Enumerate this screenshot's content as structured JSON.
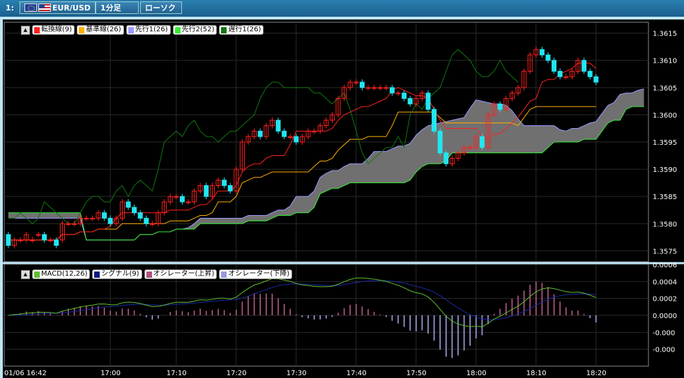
{
  "toolbar": {
    "index": "1:",
    "symbol": "EUR/USD",
    "timeframe": "1分足",
    "chart_style": "ローソク"
  },
  "legend_main": [
    {
      "label": "転換線(9)",
      "color": "#ff2020"
    },
    {
      "label": "基準線(26)",
      "color": "#ffb000"
    },
    {
      "label": "先行1(26)",
      "color": "#9999ff"
    },
    {
      "label": "先行2(52)",
      "color": "#33ee33"
    },
    {
      "label": "遅行1(26)",
      "color": "#117711"
    }
  ],
  "legend_sub": [
    {
      "label": "MACD(12,26)",
      "color": "#5fbf2f"
    },
    {
      "label": "シグナル(9)",
      "color": "#0a1a80"
    },
    {
      "label": "オシレーター(上昇)",
      "color": "#b05080"
    },
    {
      "label": "オシレーター(下降)",
      "color": "#9999dd"
    }
  ],
  "collapse_symbol": "▲",
  "colors": {
    "up": "#ff2020",
    "down": "#22e5f0",
    "cloud": "#707070",
    "grid": "#2a2a2a",
    "tenkan": "#ff2020",
    "kijun": "#ffb000",
    "senkou_a": "#9999ff",
    "senkou_b": "#33ee33",
    "chikou": "#117711",
    "macd": "#5fbf2f",
    "signal": "#1c2aa0",
    "osc_up": "#c06090",
    "osc_down": "#aaaaee"
  },
  "chart_data": [
    {
      "type": "candlestick",
      "title": "EUR/USD",
      "y_ticks": [
        "1.3615",
        "1.3610",
        "1.3605",
        "1.3600",
        "1.3595",
        "1.3590",
        "1.3585",
        "1.3580",
        "1.3575"
      ],
      "ylim": [
        1.3573,
        1.3617
      ],
      "x_ticks": [
        "01/06 16:42",
        "17:00",
        "17:10",
        "17:20",
        "17:30",
        "17:40",
        "17:50",
        "18:00",
        "18:10",
        "18:20"
      ],
      "bars": 100,
      "candles": [
        [
          1.3578,
          1.3576
        ],
        [
          1.3576,
          1.3577
        ],
        [
          1.3577,
          1.3577
        ],
        [
          1.3577,
          1.3578
        ],
        [
          1.3577,
          1.3577
        ],
        [
          1.3578,
          1.3578
        ],
        [
          1.3578,
          1.3577
        ],
        [
          1.3577,
          1.3577
        ],
        [
          1.3577,
          1.3576
        ],
        [
          1.3577,
          1.358
        ],
        [
          1.358,
          1.358
        ],
        [
          1.358,
          1.358
        ],
        [
          1.358,
          1.3581
        ],
        [
          1.3581,
          1.3581
        ],
        [
          1.3581,
          1.3581
        ],
        [
          1.3581,
          1.3582
        ],
        [
          1.3582,
          1.3581
        ],
        [
          1.3581,
          1.358
        ],
        [
          1.358,
          1.3581
        ],
        [
          1.3581,
          1.3584
        ],
        [
          1.3584,
          1.3583
        ],
        [
          1.3583,
          1.3582
        ],
        [
          1.3582,
          1.3581
        ],
        [
          1.3581,
          1.358
        ],
        [
          1.358,
          1.358
        ],
        [
          1.358,
          1.3582
        ],
        [
          1.3582,
          1.3584
        ],
        [
          1.3584,
          1.3585
        ],
        [
          1.3585,
          1.3585
        ],
        [
          1.3585,
          1.3584
        ],
        [
          1.3584,
          1.3584
        ],
        [
          1.3584,
          1.3586
        ],
        [
          1.3586,
          1.3587
        ],
        [
          1.3587,
          1.3585
        ],
        [
          1.3585,
          1.3587
        ],
        [
          1.3587,
          1.3588
        ],
        [
          1.3588,
          1.3587
        ],
        [
          1.3587,
          1.3586
        ],
        [
          1.3586,
          1.359
        ],
        [
          1.359,
          1.3595
        ],
        [
          1.3595,
          1.3596
        ],
        [
          1.3596,
          1.3597
        ],
        [
          1.3597,
          1.3596
        ],
        [
          1.3596,
          1.3598
        ],
        [
          1.3598,
          1.3599
        ],
        [
          1.3599,
          1.3597
        ],
        [
          1.3597,
          1.3596
        ],
        [
          1.3596,
          1.3596
        ],
        [
          1.3596,
          1.3595
        ],
        [
          1.3595,
          1.3596
        ],
        [
          1.3596,
          1.3597
        ],
        [
          1.3597,
          1.3597
        ],
        [
          1.3597,
          1.3598
        ],
        [
          1.3598,
          1.3599
        ],
        [
          1.3599,
          1.36
        ],
        [
          1.36,
          1.3603
        ],
        [
          1.3603,
          1.3605
        ],
        [
          1.3605,
          1.3606
        ],
        [
          1.3606,
          1.3606
        ],
        [
          1.3606,
          1.3605
        ],
        [
          1.3605,
          1.3605
        ],
        [
          1.3605,
          1.3605
        ],
        [
          1.3605,
          1.3605
        ],
        [
          1.3605,
          1.3605
        ],
        [
          1.3605,
          1.3604
        ],
        [
          1.3604,
          1.3604
        ],
        [
          1.3604,
          1.3603
        ],
        [
          1.3603,
          1.3602
        ],
        [
          1.3602,
          1.3603
        ],
        [
          1.3603,
          1.3604
        ],
        [
          1.3604,
          1.3601
        ],
        [
          1.3601,
          1.3597
        ],
        [
          1.3597,
          1.3593
        ],
        [
          1.3593,
          1.3591
        ],
        [
          1.3591,
          1.3592
        ],
        [
          1.3592,
          1.3593
        ],
        [
          1.3593,
          1.3594
        ],
        [
          1.3594,
          1.3594
        ],
        [
          1.3594,
          1.3596
        ],
        [
          1.3596,
          1.3594
        ],
        [
          1.3594,
          1.36
        ],
        [
          1.36,
          1.3602
        ],
        [
          1.3602,
          1.3601
        ],
        [
          1.3601,
          1.3603
        ],
        [
          1.3603,
          1.3604
        ],
        [
          1.3604,
          1.3605
        ],
        [
          1.3605,
          1.3608
        ],
        [
          1.3608,
          1.3611
        ],
        [
          1.3611,
          1.3612
        ],
        [
          1.3612,
          1.3611
        ],
        [
          1.3611,
          1.361
        ],
        [
          1.361,
          1.3608
        ],
        [
          1.3608,
          1.3607
        ],
        [
          1.3607,
          1.3607
        ],
        [
          1.3607,
          1.3608
        ],
        [
          1.3608,
          1.361
        ],
        [
          1.361,
          1.3608
        ],
        [
          1.3608,
          1.3607
        ],
        [
          1.3607,
          1.3606
        ]
      ]
    },
    {
      "type": "line",
      "title": "MACD(12,26)",
      "y_ticks": [
        "0.0006",
        "0.0004",
        "0.0002",
        "0.0000",
        "-0.000",
        "-0.000"
      ],
      "ylim": [
        -0.0006,
        0.0006
      ]
    }
  ]
}
